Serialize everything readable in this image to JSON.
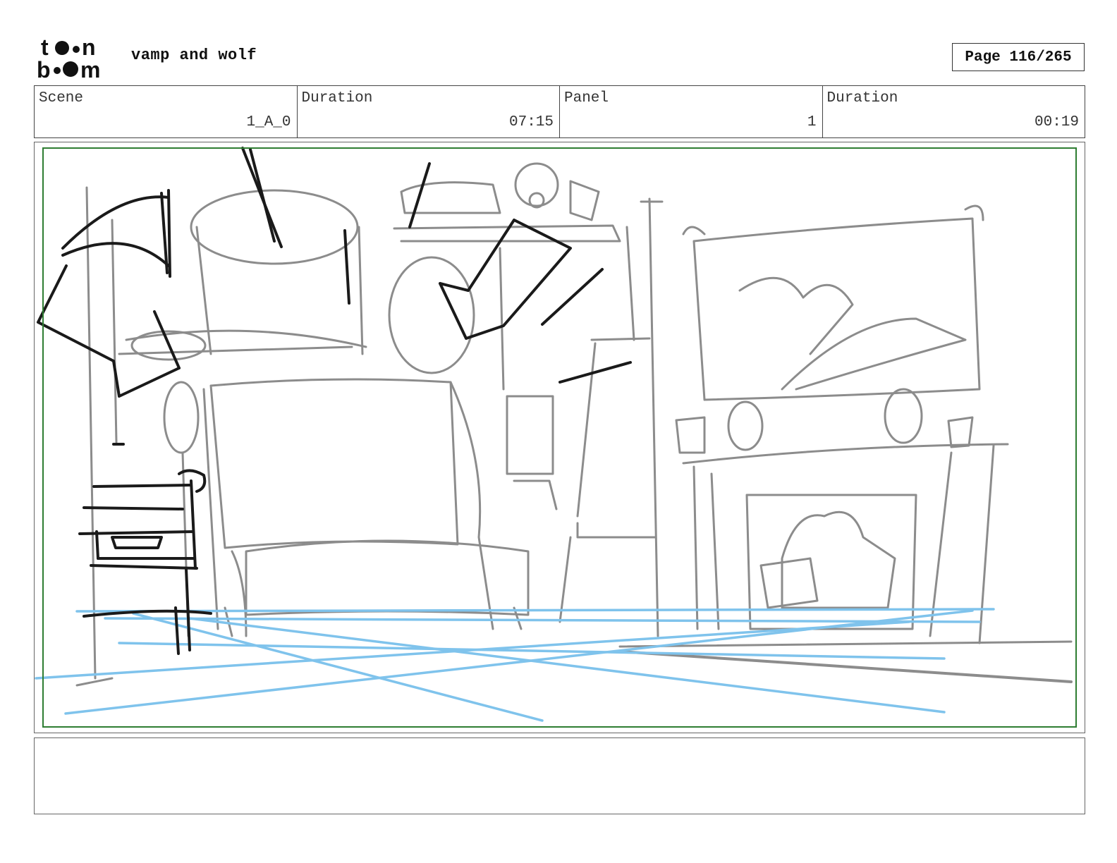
{
  "header": {
    "logo_icon": "toon-boom-logo",
    "project_title": "vamp and wolf",
    "page_label": "Page 116/265"
  },
  "info": {
    "scene_label": "Scene",
    "scene_value": "1_A_0",
    "scene_duration_label": "Duration",
    "scene_duration_value": "07:15",
    "panel_label": "Panel",
    "panel_value": "1",
    "panel_duration_label": "Duration",
    "panel_duration_value": "00:19"
  },
  "panel": {
    "image": "storyboard-sketch-living-room",
    "frame_color": "#2e7d32",
    "guide_color": "#7fc3ec",
    "sketch_color": "#8c8c8c",
    "ink_color": "#1a1a1a"
  },
  "notes": {
    "text": ""
  }
}
